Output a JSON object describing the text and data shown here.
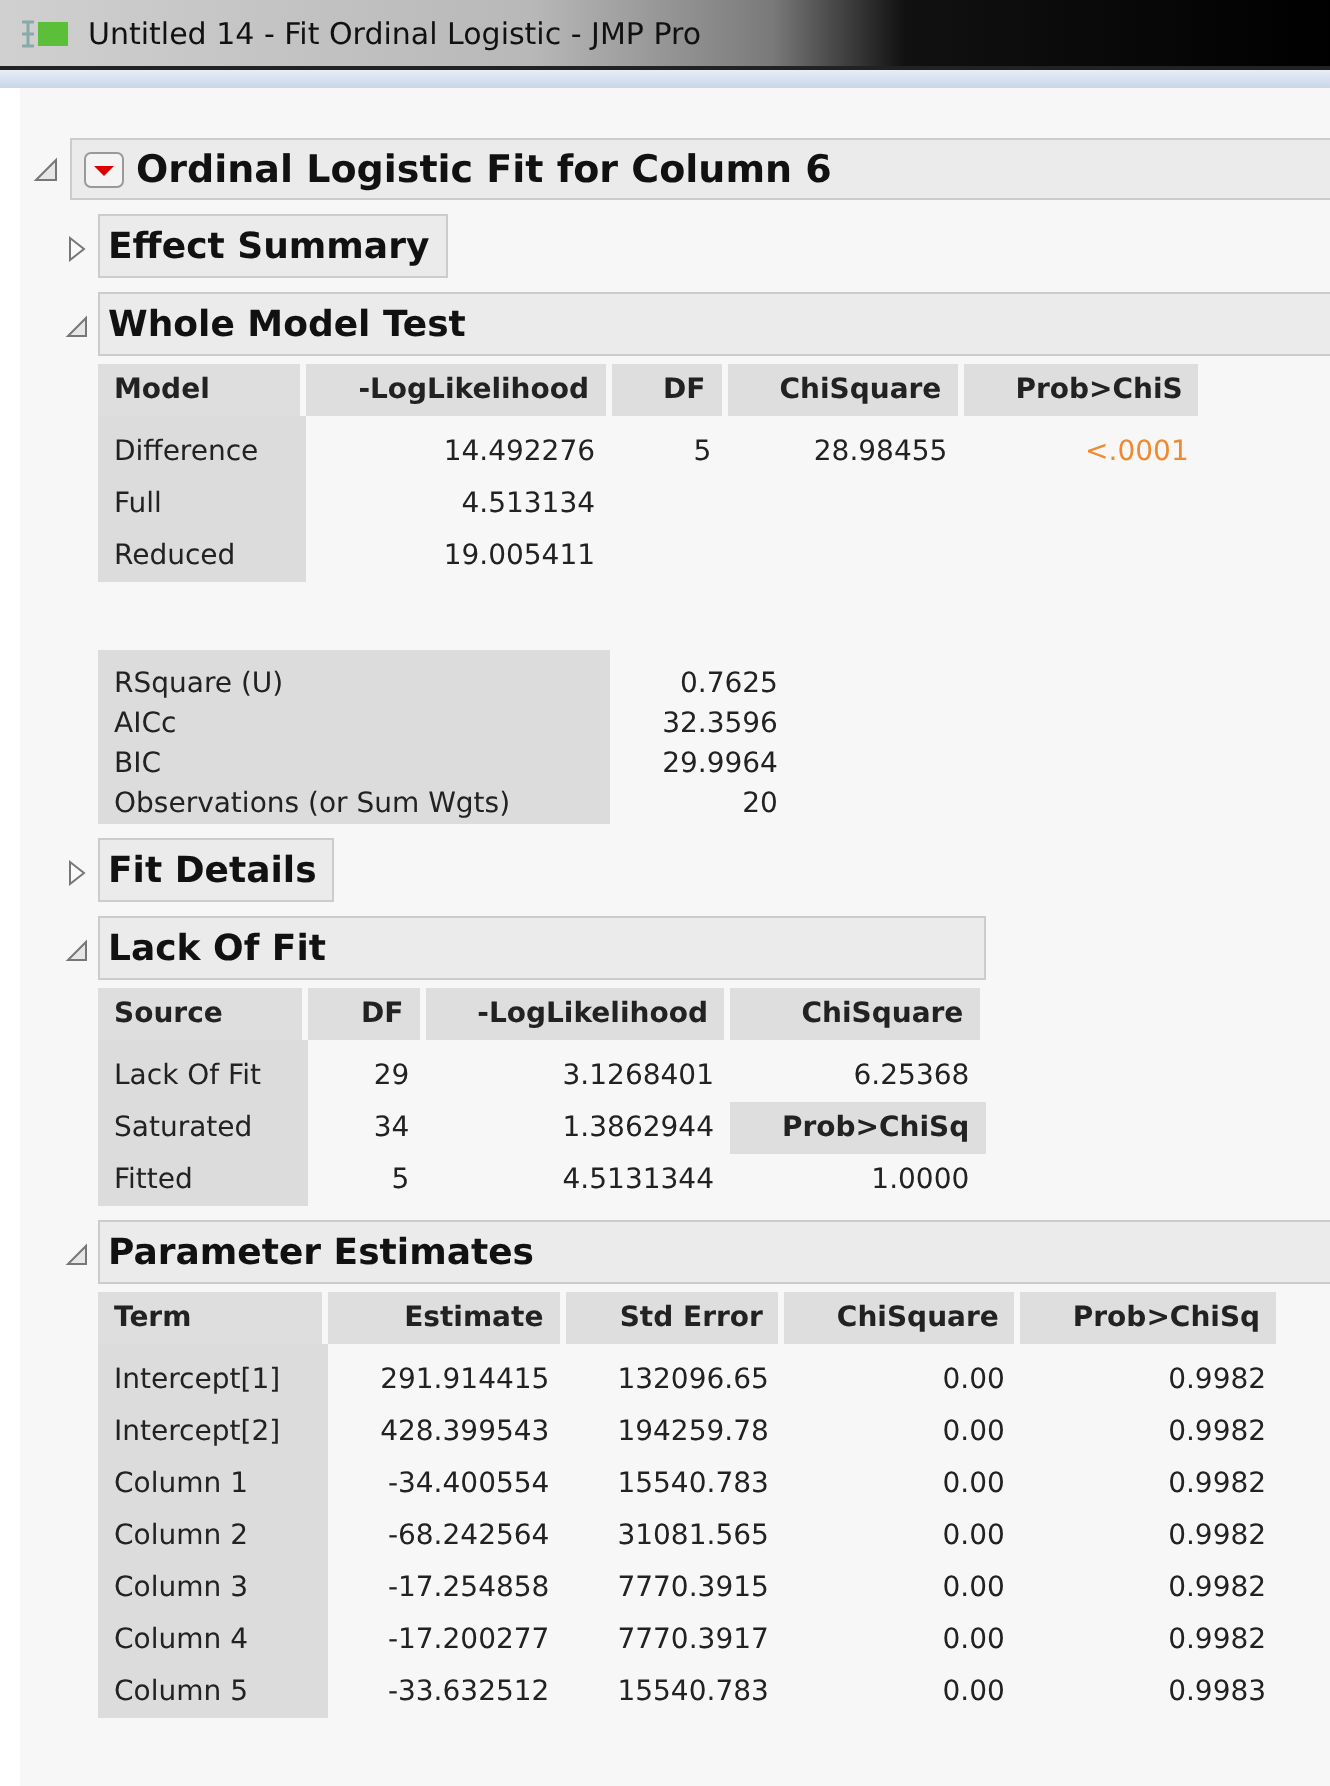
{
  "window": {
    "title": "Untitled 14 - Fit Ordinal Logistic - JMP Pro"
  },
  "report": {
    "title": "Ordinal Logistic Fit for Column 6",
    "expanded": true,
    "sections": [
      {
        "title": "Effect Summary",
        "expanded": false
      },
      {
        "title": "Whole Model Test",
        "expanded": true,
        "tables": [
          {
            "columns": [
              "Model",
              "-LogLikelihood",
              "DF",
              "ChiSquare",
              "Prob>ChiS"
            ],
            "rows": [
              [
                "Difference",
                "14.492276",
                "5",
                "28.98455",
                {
                  "text": "<.0001",
                  "kind": "significant"
                }
              ],
              [
                "Full",
                "4.513134",
                "",
                "",
                ""
              ],
              [
                "Reduced",
                "19.005411",
                "",
                "",
                ""
              ]
            ]
          },
          {
            "rows": [
              [
                "RSquare (U)",
                "0.7625"
              ],
              [
                "AICc",
                "32.3596"
              ],
              [
                "BIC",
                "29.9964"
              ],
              [
                "Observations (or Sum Wgts)",
                "20"
              ]
            ]
          }
        ]
      },
      {
        "title": "Fit Details",
        "expanded": false
      },
      {
        "title": "Lack Of Fit",
        "expanded": true,
        "tables": [
          {
            "columns": [
              "Source",
              "DF",
              "-LogLikelihood",
              "ChiSquare"
            ],
            "rows": [
              [
                "Lack Of Fit",
                "29",
                "3.1268401",
                "6.25368"
              ],
              [
                "Saturated",
                "34",
                "1.3862944",
                {
                  "text": "Prob>ChiSq",
                  "kind": "heading"
                }
              ],
              [
                "Fitted",
                "5",
                "4.5131344",
                "1.0000"
              ]
            ]
          }
        ]
      },
      {
        "title": "Parameter Estimates",
        "expanded": true,
        "tables": [
          {
            "columns": [
              "Term",
              "Estimate",
              "Std Error",
              "ChiSquare",
              "Prob>ChiSq"
            ],
            "rows": [
              [
                "Intercept[1]",
                "291.914415",
                "132096.65",
                "0.00",
                "0.9982"
              ],
              [
                "Intercept[2]",
                "428.399543",
                "194259.78",
                "0.00",
                "0.9982"
              ],
              [
                "Column 1",
                "-34.400554",
                "15540.783",
                "0.00",
                "0.9982"
              ],
              [
                "Column 2",
                "-68.242564",
                "31081.565",
                "0.00",
                "0.9982"
              ],
              [
                "Column 3",
                "-17.254858",
                "7770.3915",
                "0.00",
                "0.9982"
              ],
              [
                "Column 4",
                "-17.200277",
                "7770.3917",
                "0.00",
                "0.9982"
              ],
              [
                "Column 5",
                "-33.632512",
                "15540.783",
                "0.00",
                "0.9983"
              ]
            ]
          }
        ]
      }
    ]
  }
}
